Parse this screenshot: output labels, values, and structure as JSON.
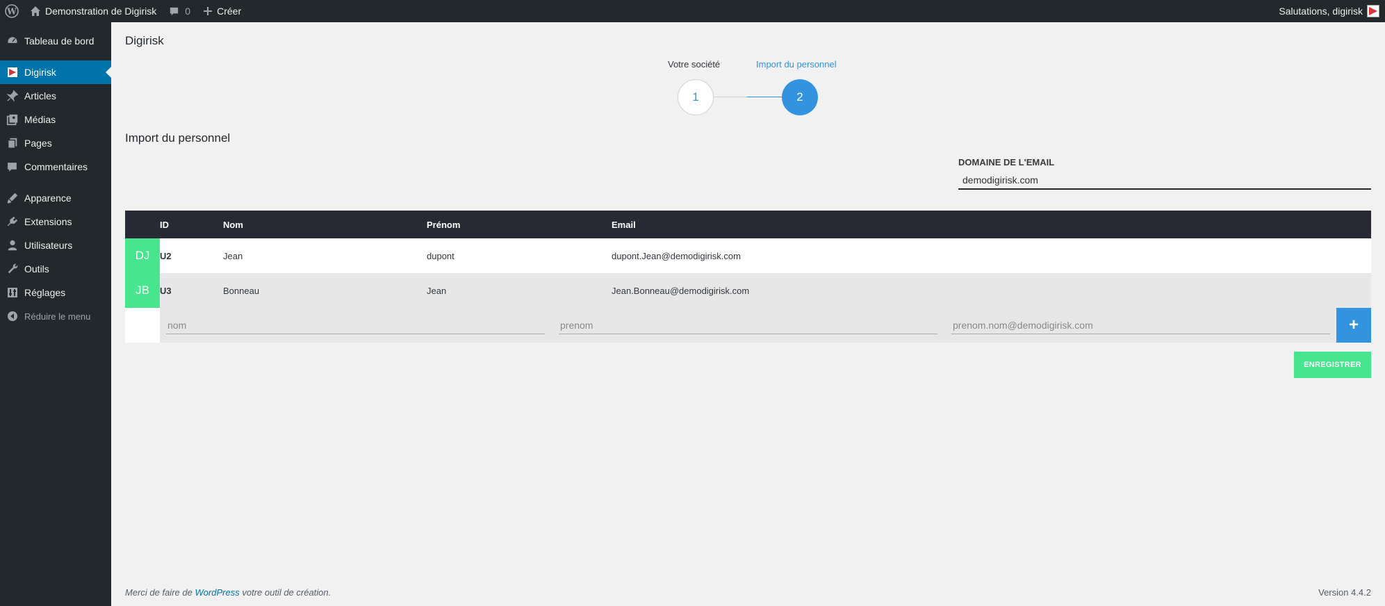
{
  "adminbar": {
    "site_name": "Demonstration de Digirisk",
    "comments_count": "0",
    "new_label": "Créer",
    "greeting": "Salutations, digirisk"
  },
  "sidebar": {
    "items": [
      {
        "label": "Tableau de bord",
        "icon": "dashboard-icon"
      },
      {
        "label": "Digirisk",
        "icon": "digirisk-icon",
        "current": true
      },
      {
        "label": "Articles",
        "icon": "pin-icon"
      },
      {
        "label": "Médias",
        "icon": "media-icon"
      },
      {
        "label": "Pages",
        "icon": "pages-icon"
      },
      {
        "label": "Commentaires",
        "icon": "comments-icon"
      },
      {
        "label": "Apparence",
        "icon": "appearance-icon"
      },
      {
        "label": "Extensions",
        "icon": "plugins-icon"
      },
      {
        "label": "Utilisateurs",
        "icon": "users-icon"
      },
      {
        "label": "Outils",
        "icon": "tools-icon"
      },
      {
        "label": "Réglages",
        "icon": "settings-icon"
      }
    ],
    "collapse_label": "Réduire le menu"
  },
  "page": {
    "title": "Digirisk",
    "steps": [
      {
        "label": "Votre société",
        "number": "1"
      },
      {
        "label": "Import du personnel",
        "number": "2",
        "active": true
      }
    ],
    "section_title": "Import du personnel",
    "email_domain": {
      "label": "DOMAINE DE L'EMAIL",
      "value": "demodigirisk.com"
    },
    "table": {
      "headers": {
        "id": "ID",
        "nom": "Nom",
        "prenom": "Prénom",
        "email": "Email"
      },
      "rows": [
        {
          "initials": "DJ",
          "id": "U2",
          "nom": "Jean",
          "prenom": "dupont",
          "email": "dupont.Jean@demodigirisk.com"
        },
        {
          "initials": "JB",
          "id": "U3",
          "nom": "Bonneau",
          "prenom": "Jean",
          "email": "Jean.Bonneau@demodigirisk.com"
        }
      ],
      "new_row": {
        "nom_placeholder": "nom",
        "prenom_placeholder": "prenom",
        "email_placeholder": "prenom.nom@demodigirisk.com",
        "add_label": "+"
      }
    },
    "save_label": "ENREGISTRER"
  },
  "footer": {
    "text_before": "Merci de faire de ",
    "link": "WordPress",
    "text_after": " votre outil de création.",
    "version": "Version 4.4.2"
  },
  "colors": {
    "accent_blue": "#3393df",
    "green": "#47e58e",
    "admin_dark": "#23282d",
    "menu_current": "#0073aa"
  }
}
